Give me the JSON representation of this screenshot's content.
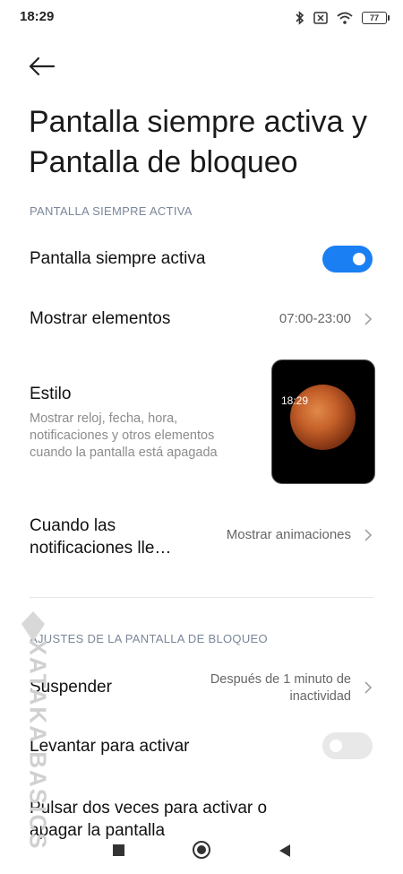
{
  "status_bar": {
    "time": "18:29",
    "battery": "77",
    "icons": [
      "bluetooth-icon",
      "sim-off-icon",
      "wifi-icon",
      "battery-icon"
    ]
  },
  "page": {
    "title": "Pantalla siempre activa y Pantalla de bloqueo"
  },
  "aod_section": {
    "header": "PANTALLA SIEMPRE ACTIVA",
    "always_on": {
      "label": "Pantalla siempre activa",
      "enabled": true
    },
    "show_items": {
      "label": "Mostrar elementos",
      "value": "07:00-23:00"
    },
    "style": {
      "label": "Estilo",
      "description": "Mostrar reloj, fecha, hora, notificaciones y otros elementos cuando la pantalla está apagada",
      "preview_time": "18:29"
    },
    "notifications": {
      "label_line1": "Cuando las",
      "label_line2": "notificaciones lle…",
      "value": "Mostrar animaciones"
    }
  },
  "lock_section": {
    "header": "AJUSTES DE LA PANTALLA DE BLOQUEO",
    "sleep": {
      "label": "Suspender",
      "value_line1": "Después de 1 minuto de",
      "value_line2": "inactividad"
    },
    "raise_to_wake": {
      "label": "Levantar para activar",
      "enabled": false
    },
    "double_tap": {
      "label_line1": "Pulsar dos veces para activar o",
      "label_line2": "apagar la pantalla"
    }
  },
  "watermark": "XATAKA BASICS",
  "colors": {
    "accent": "#1a7ff3",
    "section_header": "#7a8699"
  }
}
